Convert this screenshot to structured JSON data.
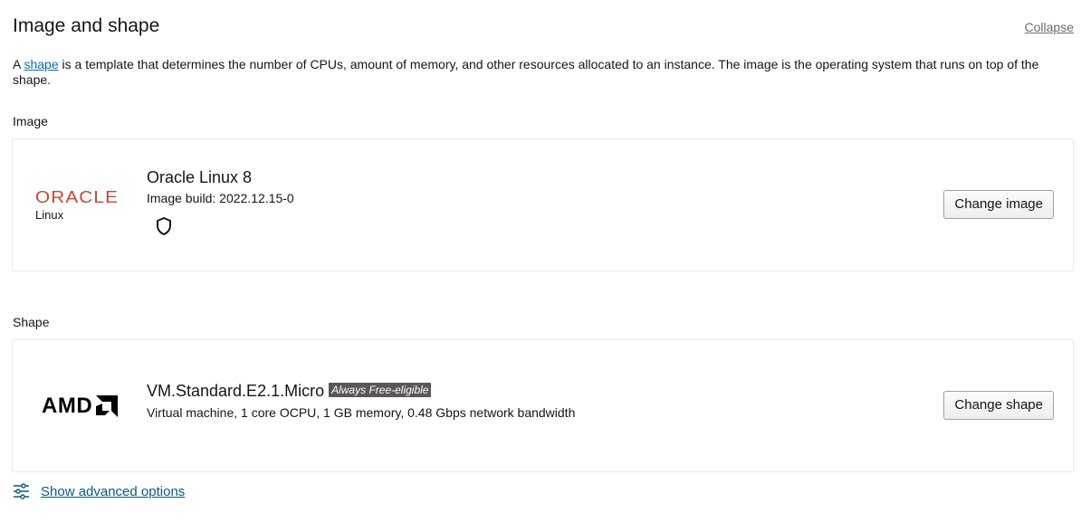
{
  "section": {
    "title": "Image and shape",
    "collapse_label": "Collapse",
    "description_prefix": "A ",
    "description_link": "shape",
    "description_suffix": " is a template that determines the number of CPUs, amount of memory, and other resources allocated to an instance. The image is the operating system that runs on top of the shape."
  },
  "image": {
    "label": "Image",
    "logo_text": "ORACLE",
    "logo_subtext": "Linux",
    "name": "Oracle Linux 8",
    "build": "Image build: 2022.12.15-0",
    "security_icon": "shield-icon",
    "change_button": "Change image"
  },
  "shape": {
    "label": "Shape",
    "logo_text": "AMD",
    "name": "VM.Standard.E2.1.Micro",
    "badge": "Always Free-eligible",
    "details": "Virtual machine, 1 core OCPU, 1 GB memory, 0.48 Gbps network bandwidth",
    "change_button": "Change shape"
  },
  "advanced": {
    "label": "Show advanced options",
    "icon": "sliders-icon"
  },
  "colors": {
    "oracle_red": "#c74634",
    "link_blue": "#0a6ebd",
    "badge_bg": "#5a5754"
  }
}
